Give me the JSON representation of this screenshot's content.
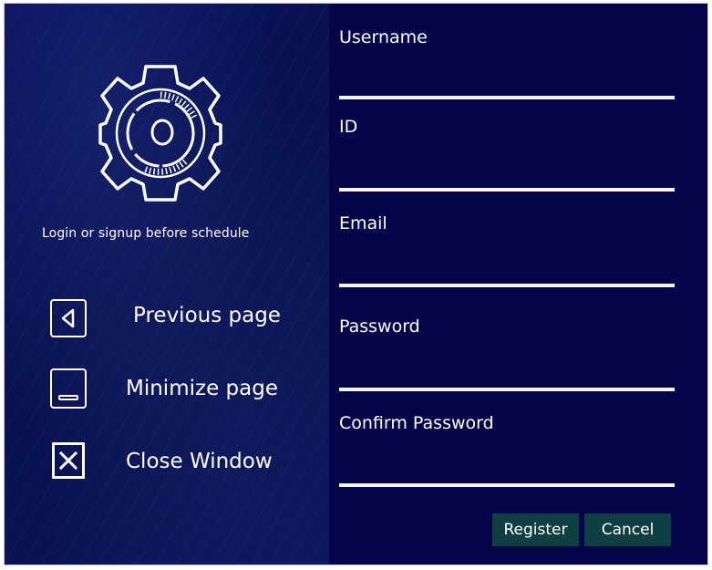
{
  "left": {
    "tagline": "Login or signup before schedule",
    "nav": {
      "previous_label": "Previous page",
      "minimize_label": "Minimize page",
      "close_label": "Close Window"
    }
  },
  "icons": {
    "logo": "gear-icon",
    "previous": "triangle-left-icon",
    "minimize": "minimize-icon",
    "close": "close-x-icon"
  },
  "form": {
    "username_label": "Username",
    "username_value": "",
    "id_label": "ID",
    "id_value": "",
    "email_label": "Email",
    "email_value": "",
    "password_label": "Password",
    "password_value": "",
    "confirm_label": "Confirm Password",
    "confirm_value": ""
  },
  "buttons": {
    "register": "Register",
    "cancel": "Cancel"
  },
  "colors": {
    "background": "#04044a",
    "button": "#0d3f43",
    "underline": "#f3f3f3"
  }
}
